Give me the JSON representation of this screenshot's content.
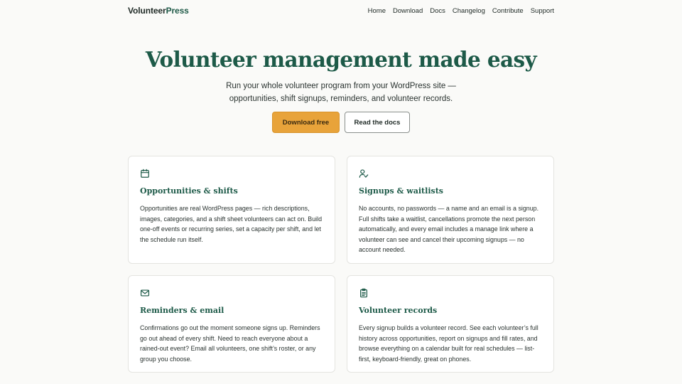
{
  "header": {
    "logo_prefix": "Volunteer",
    "logo_suffix": "Press",
    "nav": [
      "Home",
      "Download",
      "Docs",
      "Changelog",
      "Contribute",
      "Support"
    ]
  },
  "hero": {
    "title": "Volunteer management made easy",
    "subtitle_line1": "Run your whole volunteer program from your WordPress site —",
    "subtitle_line2": "opportunities, shift signups, reminders, and volunteer records.",
    "primary_button": "Download free",
    "secondary_button": "Read the docs"
  },
  "features": [
    {
      "icon": "calendar-icon",
      "title": "Opportunities & shifts",
      "body": "Opportunities are real WordPress pages — rich descriptions, images, categories, and a shift sheet volunteers can act on. Build one-off events or recurring series, set a capacity per shift, and let the schedule run itself."
    },
    {
      "icon": "user-check-icon",
      "title": "Signups & waitlists",
      "body": "No accounts, no passwords — a name and an email is a signup. Full shifts take a waitlist, cancellations promote the next person automatically, and every email includes a manage link where a volunteer can see and cancel their upcoming signups — no account needed."
    },
    {
      "icon": "mail-icon",
      "title": "Reminders & email",
      "body": "Confirmations go out the moment someone signs up. Reminders go out ahead of every shift. Need to reach everyone about a rained-out event? Email all volunteers, one shift’s roster, or any group you choose."
    },
    {
      "icon": "clipboard-icon",
      "title": "Volunteer records",
      "body": "Every signup builds a volunteer record. See each volunteer’s full history across opportunities, report on signups and fill rates, and browse everything on a calendar built for real schedules — list-first, keyboard-friendly, great on phones."
    }
  ],
  "colors": {
    "accent": "#1d5a48",
    "primary_button": "#e8a33a",
    "background": "#fafaf8"
  }
}
